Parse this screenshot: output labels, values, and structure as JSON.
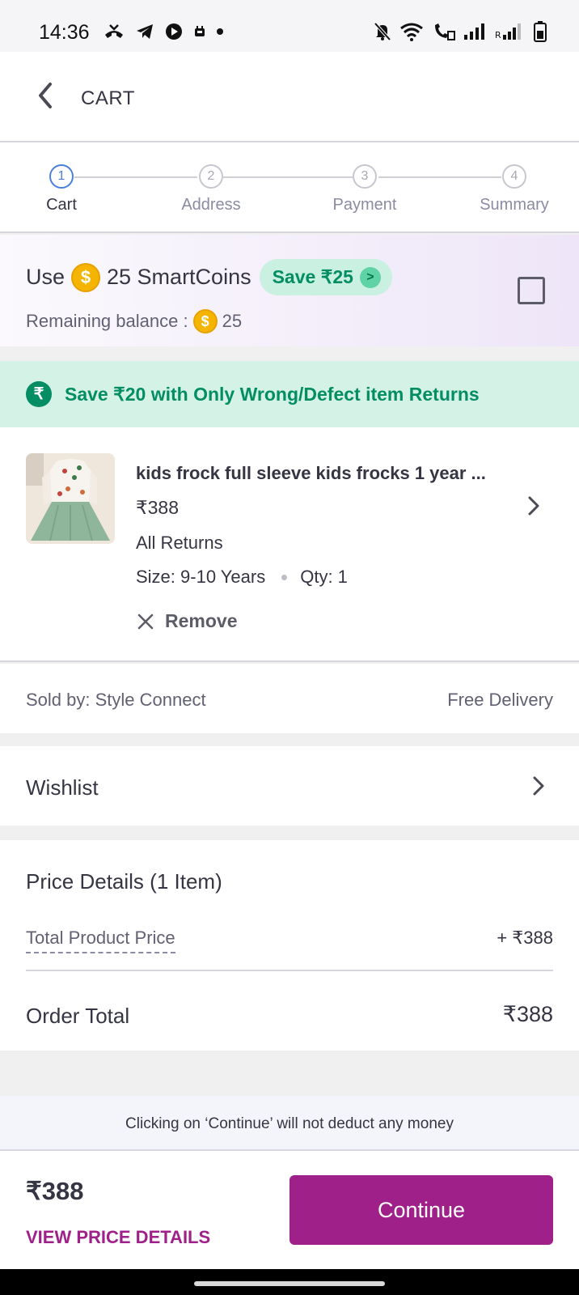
{
  "status_bar": {
    "time": "14:36",
    "left_icons": [
      "missed-call-icon",
      "telegram-icon",
      "play-icon",
      "notification-icon",
      "dot-icon"
    ],
    "right_icons": [
      "bell-muted-icon",
      "wifi-icon",
      "wifi-call-icon",
      "signal-icon",
      "signal-roaming-icon",
      "battery-icon"
    ]
  },
  "header": {
    "title": "CART"
  },
  "stepper": {
    "steps": [
      {
        "number": "1",
        "label": "Cart",
        "active": true
      },
      {
        "number": "2",
        "label": "Address",
        "active": false
      },
      {
        "number": "3",
        "label": "Payment",
        "active": false
      },
      {
        "number": "4",
        "label": "Summary",
        "active": false
      }
    ]
  },
  "smartcoins": {
    "use_label": "Use",
    "coins_label": "25 SmartCoins",
    "save_label": "Save ₹25",
    "balance_label": "Remaining balance :",
    "balance_value": "25",
    "checked": false
  },
  "returns_banner": {
    "text": "Save ₹20 with Only Wrong/Defect item Returns"
  },
  "product": {
    "title": "kids frock full sleeve kids frocks 1 year ...",
    "price": "₹388",
    "returns": "All Returns",
    "size": "Size: 9-10 Years",
    "qty": "Qty: 1",
    "remove_label": "Remove"
  },
  "seller": {
    "sold_by": "Sold by: Style Connect",
    "delivery": "Free Delivery"
  },
  "wishlist": {
    "label": "Wishlist"
  },
  "price_details": {
    "title": "Price Details (1 Item)",
    "total_product_price_label": "Total Product Price",
    "total_product_price_value": "+ ₹388",
    "order_total_label": "Order Total",
    "order_total_value": "₹388"
  },
  "notice": {
    "text": "Clicking on ‘Continue’ will not deduct any money"
  },
  "bottom_bar": {
    "total": "₹388",
    "view_details": "VIEW PRICE DETAILS",
    "continue_label": "Continue"
  },
  "colors": {
    "brand_purple": "#9f2089",
    "green": "#038d63",
    "step_active": "#4a7fdc"
  }
}
